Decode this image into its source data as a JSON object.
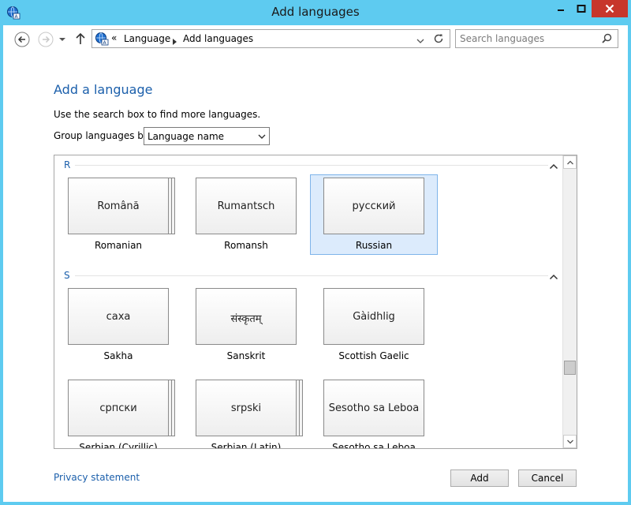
{
  "window": {
    "title": "Add languages",
    "icon": "language-globe-icon",
    "controls": {
      "minimize": "minimize-icon",
      "maximize": "maximize-icon",
      "close": "close-icon"
    }
  },
  "nav": {
    "back_icon": "back-arrow-icon",
    "forward_icon": "forward-arrow-icon",
    "recent_icon": "chevron-down-icon",
    "up_icon": "up-arrow-icon"
  },
  "address": {
    "prefix": "«",
    "crumbs": [
      "Language",
      "Add languages"
    ],
    "dropdown_icon": "chevron-down-icon",
    "refresh_icon": "refresh-icon"
  },
  "search": {
    "placeholder": "Search languages",
    "value": "",
    "icon": "search-icon"
  },
  "page": {
    "heading": "Add a language",
    "description": "Use the search box to find more languages.",
    "group_label": "Group languages by:",
    "group_value": "Language name"
  },
  "groups": [
    {
      "letter": "R",
      "languages": [
        {
          "native": "Română",
          "english": "Romanian",
          "stacked": true,
          "selected": false
        },
        {
          "native": "Rumantsch",
          "english": "Romansh",
          "stacked": false,
          "selected": false
        },
        {
          "native": "русский",
          "english": "Russian",
          "stacked": false,
          "selected": true
        }
      ]
    },
    {
      "letter": "S",
      "languages": [
        {
          "native": "саха",
          "english": "Sakha",
          "stacked": false,
          "selected": false
        },
        {
          "native": "संस्कृतम्",
          "english": "Sanskrit",
          "stacked": false,
          "selected": false
        },
        {
          "native": "Gàidhlig",
          "english": "Scottish Gaelic",
          "stacked": false,
          "selected": false
        },
        {
          "native": "српски",
          "english": "Serbian (Cyrillic)",
          "stacked": true,
          "selected": false
        },
        {
          "native": "srpski",
          "english": "Serbian (Latin)",
          "stacked": true,
          "selected": false
        },
        {
          "native": "Sesotho sa Leboa",
          "english": "Sesotho sa Leboa",
          "stacked": false,
          "selected": false
        }
      ]
    }
  ],
  "footer": {
    "privacy": "Privacy statement",
    "add": "Add",
    "cancel": "Cancel"
  },
  "colors": {
    "titlebar": "#5ecbf0",
    "accent_text": "#1b5fab",
    "selection_bg": "#dcebfc",
    "close_button": "#c7362b"
  }
}
